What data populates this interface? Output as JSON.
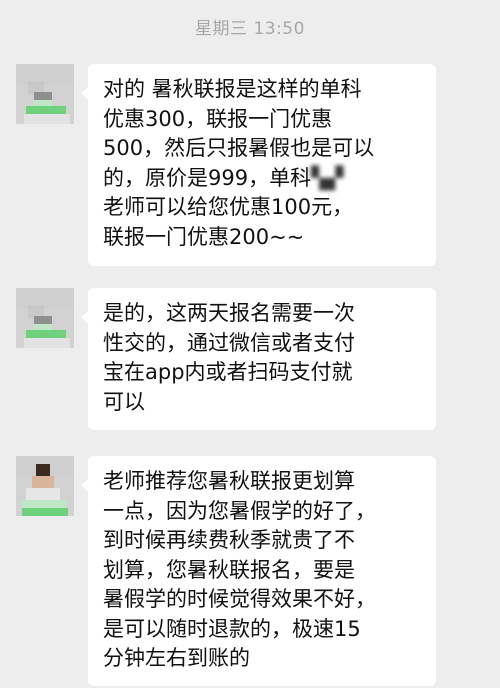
{
  "header": {
    "timestamp": "星期三 13:50"
  },
  "messages": [
    {
      "lines": [
        "对的 暑秋联报是这样的单科",
        "优惠300，联报一门优惠",
        "500，然后只报暑假也是可以",
        "的，原价是999，单科",
        "老师可以给您优惠100元，",
        "联报一门优惠200~~"
      ],
      "redacted_suffix": "▚▞"
    },
    {
      "lines": [
        "是的，这两天报名需要一次",
        "性交的，通过微信或者支付",
        "宝在app内或者扫码支付就",
        "可以"
      ]
    },
    {
      "lines": [
        "老师推荐您暑秋联报更划算",
        "一点，因为您暑假学的好了，",
        "到时候再续费秋季就贵了不",
        "划算，您暑秋联报名，要是",
        "暑假学的时候觉得效果不好，",
        "是可以随时退款的，极速15",
        "分钟左右到账的"
      ]
    }
  ],
  "colors": {
    "background": "#ededed",
    "bubble": "#ffffff",
    "text": "#111111",
    "timestamp": "#a8a8a8",
    "avatar_green": "#3cb95a"
  },
  "icons": {
    "avatar": "pixelated-avatar-icon"
  }
}
